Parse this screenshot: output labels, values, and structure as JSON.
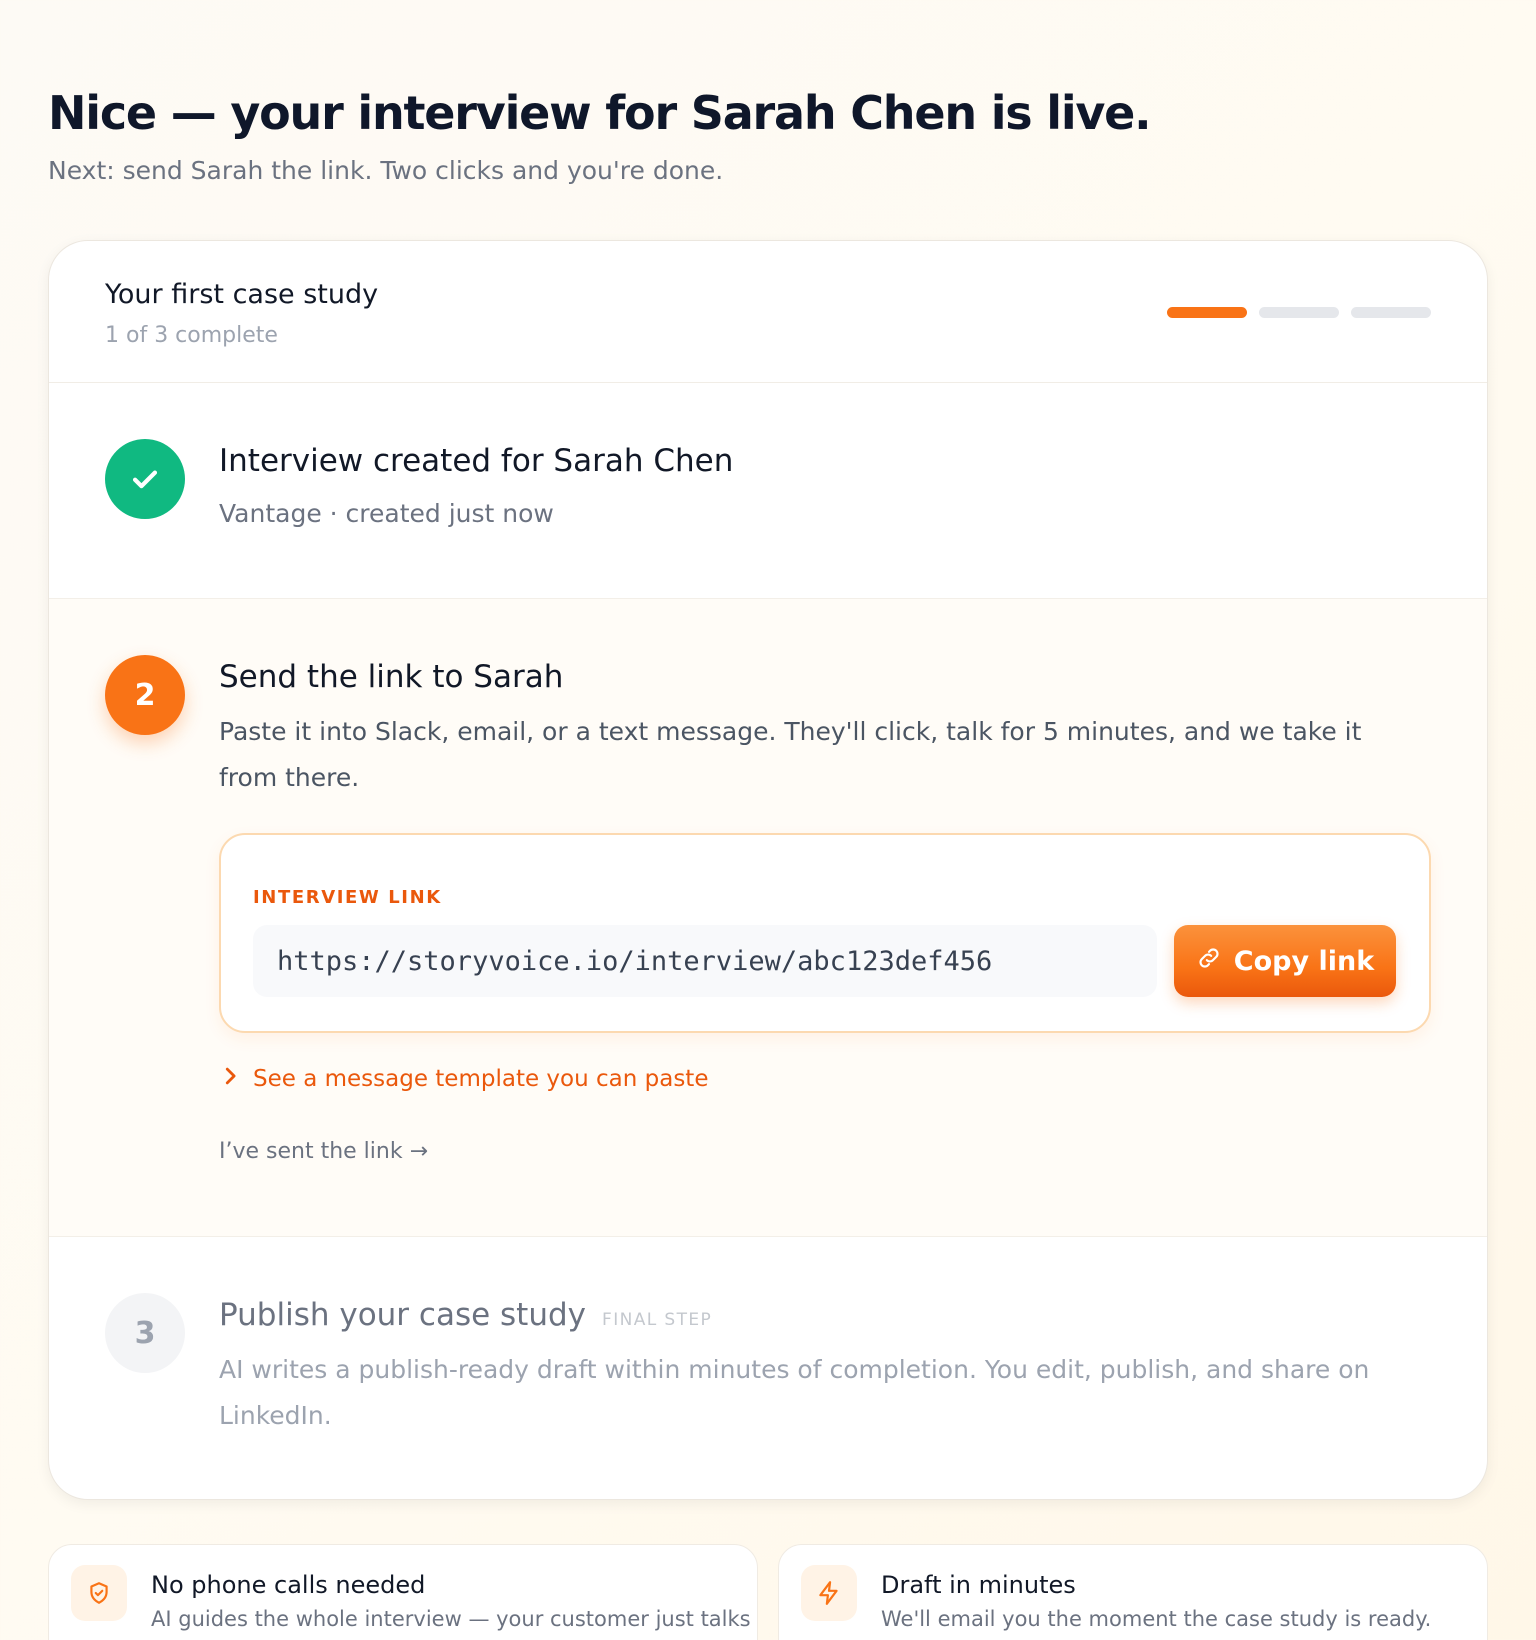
{
  "header": {
    "title": "Nice — your interview for Sarah Chen is live.",
    "subtitle": "Next: send Sarah the link. Two clicks and you're done."
  },
  "card": {
    "title": "Your first case study",
    "progress_text": "1 of 3 complete",
    "progress": {
      "completed": 1,
      "total": 3
    },
    "accent_color": "#f97316",
    "success_color": "#10b981"
  },
  "steps": [
    {
      "title": "Interview created for Sarah Chen",
      "meta": "Vantage · created just now",
      "status": "complete"
    },
    {
      "number": "2",
      "title": "Send the link to Sarah",
      "description": "Paste it into Slack, email, or a text message. They'll click, talk for 5 minutes, and we take it from there.",
      "status": "current",
      "link_label": "INTERVIEW LINK",
      "link_value": "https://storyvoice.io/interview/abc123def456",
      "copy_label": "Copy link",
      "template_label": "See a message template you can paste",
      "sent_label": "I’ve sent the link →"
    },
    {
      "number": "3",
      "title": "Publish your case study",
      "tag": "FINAL STEP",
      "description": "AI writes a publish-ready draft within minutes of completion. You edit, publish, and share on LinkedIn.",
      "status": "upcoming"
    }
  ],
  "features": [
    {
      "icon": "shield-check-icon",
      "title": "No phone calls needed",
      "description": "AI guides the whole interview — your customer just talks"
    },
    {
      "icon": "lightning-icon",
      "title": "Draft in minutes",
      "description": "We'll email you the moment the case study is ready."
    }
  ]
}
